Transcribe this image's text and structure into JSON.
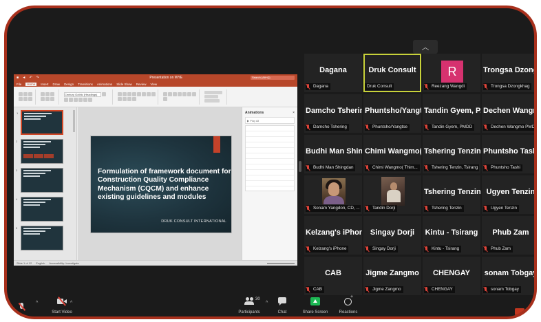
{
  "colors": {
    "frame_border": "#a8301c",
    "meeting_background": "#1b1b1b",
    "tile_background": "#232323",
    "active_speaker_border": "#c8d23a",
    "muted_icon": "#e0443a",
    "share_screen_green": "#1db954",
    "avatar_r": "#d6326f",
    "slide_background": "#1e343e",
    "slide_accent": "#c4422a",
    "powerpoint_brand": "#b7472a"
  },
  "shared_screen": {
    "window_title": "Presentation on WYE",
    "search_placeholder": "Search (Alt+Q)",
    "ribbon_tabs": [
      "File",
      "Home",
      "Insert",
      "Draw",
      "Design",
      "Transitions",
      "Animations",
      "Slide Show",
      "Review",
      "View"
    ],
    "active_tab": "Home",
    "font_box": "Century Gothic (Headings)",
    "slide_title": "Formulation of framework document for Construction Quality Compliance Mechanism (CQCM) and enhance existing guidelines and modules",
    "slide_footer": "DRUK CONSULT INTERNATIONAL",
    "thumbnail_numbers": [
      "1",
      "2",
      "3",
      "4",
      "5"
    ],
    "animation_pane": {
      "title": "Animations",
      "close": "×",
      "play_button": "▶ Play All"
    },
    "status_bar": {
      "slide_count": "Slide 1 of 12",
      "language": "English",
      "accessibility": "Accessibility: Investigate"
    }
  },
  "gallery": {
    "collapse_icon": "chevron-up-icon",
    "participants": [
      {
        "display": "Dagana",
        "label": "Dagana",
        "muted": true
      },
      {
        "display": "Druk Consult",
        "label": "Druk Consult",
        "muted": false,
        "active": true
      },
      {
        "display": "R",
        "label": "Reezang Wangdi",
        "muted": true,
        "avatar": "letter"
      },
      {
        "display": "Trongsa Dzongk...",
        "label": "Trongsa Dzongkhag",
        "muted": true
      },
      {
        "display": "Damcho Tshering",
        "label": "Damcho Tshering",
        "muted": true
      },
      {
        "display": "Phuntsho/Yangt...",
        "label": "Phuntsho/Yangtse",
        "muted": true
      },
      {
        "display": "Tandin Gyem, P...",
        "label": "Tandin Gyem, PMDD",
        "muted": true
      },
      {
        "display": "Dechen Wangm...",
        "label": "Dechen Wangmo PMDD",
        "muted": true
      },
      {
        "display": "Budhi Man Shin...",
        "label": "Budhi Man Shingdan",
        "muted": true
      },
      {
        "display": "Chimi Wangmo(...",
        "label": "Chimi Wangmo( Thim...",
        "muted": true
      },
      {
        "display": "Tshering Tenzin,...",
        "label": "Tshering Tenzin, Tsirang",
        "muted": true
      },
      {
        "display": "Phuntsho Tashi",
        "label": "Phuntsho Tashi",
        "muted": true
      },
      {
        "display": "",
        "label": "Sonam Yangdon, CD, ...",
        "muted": true,
        "avatar": "photo-a"
      },
      {
        "display": "",
        "label": "Tandin Dorji",
        "muted": true,
        "avatar": "photo-b"
      },
      {
        "display": "Tshering Tenzin",
        "label": "Tshering Tenzin",
        "muted": true
      },
      {
        "display": "Ugyen Tenzin",
        "label": "Ugyen Tenzin",
        "muted": true
      },
      {
        "display": "Kelzang's iPhone",
        "label": "Kelzang's iPhone",
        "muted": true
      },
      {
        "display": "Singay Dorji",
        "label": "Singay Dorji",
        "muted": true
      },
      {
        "display": "Kintu - Tsirang",
        "label": "Kintu - Tsirang",
        "muted": true
      },
      {
        "display": "Phub Zam",
        "label": "Phub Zam",
        "muted": true
      },
      {
        "display": "CAB",
        "label": "CAB",
        "muted": true
      },
      {
        "display": "Jigme Zangmo",
        "label": "Jigme Zangmo",
        "muted": true
      },
      {
        "display": "CHENGAY",
        "label": "CHENGAY",
        "muted": true
      },
      {
        "display": "sonam Tobgay",
        "label": "sonam Tobgay",
        "muted": true
      }
    ]
  },
  "toolbar": {
    "start_video": "Start Video",
    "participants": "Participants",
    "participant_count": "30",
    "chat": "Chat",
    "share_screen": "Share Screen",
    "reactions": "Reactions",
    "caret": "^"
  }
}
